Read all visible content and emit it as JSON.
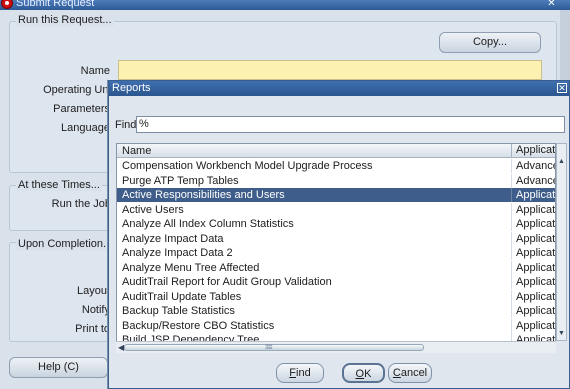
{
  "window": {
    "title": "Submit Request",
    "close_glyph": "✕"
  },
  "run_group": {
    "label": "Run this Request...",
    "copy_button": "Copy...",
    "labels": {
      "name": "Name",
      "operating_unit": "Operating Unit",
      "parameters": "Parameters",
      "language": "Language"
    }
  },
  "times_group": {
    "label": "At these Times...",
    "run_job": "Run the Job"
  },
  "completion_group": {
    "label": "Upon Completion...",
    "layout": "Layout",
    "notify": "Notify",
    "print_to": "Print to"
  },
  "help_button": "Help (C)",
  "dialog": {
    "title": "Reports",
    "close_glyph": "✕",
    "find_label": "Find",
    "find_value": "%",
    "columns": {
      "name": "Name",
      "application": "Applicati"
    },
    "rows": [
      {
        "name": "Compensation Workbench Model Upgrade Process",
        "app": "Advance"
      },
      {
        "name": "Purge ATP Temp Tables",
        "app": "Advance"
      },
      {
        "name": "Active Responsibilities and Users",
        "app": "Applicati"
      },
      {
        "name": "Active Users",
        "app": "Applicati"
      },
      {
        "name": "Analyze All Index Column Statistics",
        "app": "Applicati"
      },
      {
        "name": "Analyze Impact Data",
        "app": "Applicati"
      },
      {
        "name": "Analyze Impact Data 2",
        "app": "Applicati"
      },
      {
        "name": "Analyze Menu Tree Affected",
        "app": "Applicati"
      },
      {
        "name": "AuditTrail Report for Audit Group Validation",
        "app": "Applicati"
      },
      {
        "name": "AuditTrail Update Tables",
        "app": "Applicati"
      },
      {
        "name": "Backup Table Statistics",
        "app": "Applicati"
      },
      {
        "name": "Backup/Restore CBO Statistics",
        "app": "Applicati"
      },
      {
        "name": "Build JSP Dependency Tree",
        "app": "Applicati"
      }
    ],
    "selected_row": "Active Responsibilities and Users",
    "buttons": {
      "find": "Find",
      "ok": "OK",
      "cancel": "Cancel"
    }
  },
  "colors": {
    "selection": "#3e5d8a",
    "name_field": "#fcf1b0",
    "title_bar": "#2b568f"
  }
}
